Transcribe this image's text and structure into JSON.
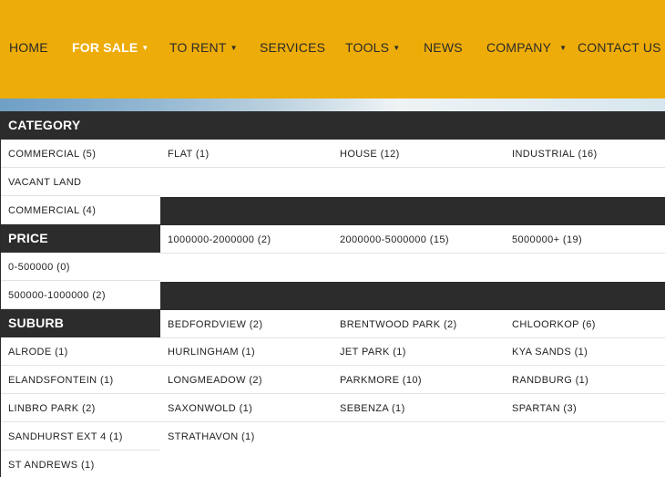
{
  "nav": {
    "home": "HOME",
    "for_sale": "FOR SALE",
    "to_rent": "TO RENT",
    "services": "SERVICES",
    "tools": "TOOLS",
    "news": "NEWS",
    "company": "COMPANY",
    "contact_us": "CONTACT US"
  },
  "category": {
    "title": "CATEGORY",
    "items": [
      "COMMERCIAL (5)",
      "FLAT (1)",
      "HOUSE (12)",
      "INDUSTRIAL (16)",
      "VACANT LAND",
      "COMMERCIAL (4)"
    ]
  },
  "price": {
    "title": "PRICE",
    "items": [
      "1000000-2000000 (2)",
      "2000000-5000000 (15)",
      "5000000+ (19)",
      "0-500000 (0)",
      "500000-1000000 (2)"
    ]
  },
  "suburb": {
    "title": "SUBURB",
    "items": [
      "BEDFORDVIEW (2)",
      "BRENTWOOD PARK (2)",
      "CHLOORKOP (6)",
      "ALRODE (1)",
      "HURLINGHAM (1)",
      "JET PARK (1)",
      "KYA SANDS (1)",
      "ELANDSFONTEIN (1)",
      "LONGMEADOW (2)",
      "PARKMORE (10)",
      "RANDBURG (1)",
      "LINBRO PARK (2)",
      "SAXONWOLD (1)",
      "SEBENZA (1)",
      "SPARTAN (3)",
      "SANDHURST EXT 4 (1)",
      "STRATHAVON (1)",
      "ST ANDREWS (1)"
    ]
  }
}
